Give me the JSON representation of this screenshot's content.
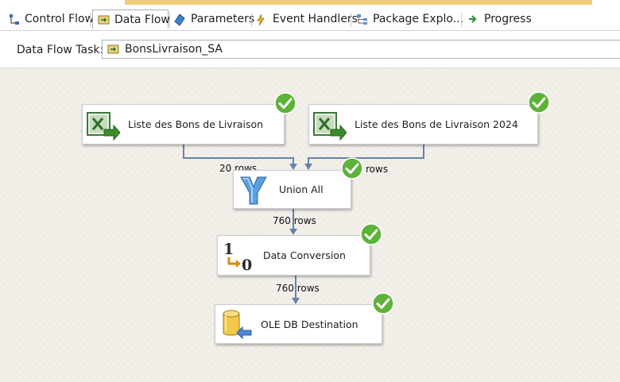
{
  "tabs": [
    {
      "label": "Control Flow",
      "icon": "control-flow-icon"
    },
    {
      "label": "Data Flow",
      "icon": "data-flow-icon",
      "active": true
    },
    {
      "label": "Parameters",
      "icon": "parameters-icon"
    },
    {
      "label": "Event Handlers",
      "icon": "event-handlers-icon"
    },
    {
      "label": "Package Explo...",
      "icon": "package-explorer-icon"
    },
    {
      "label": "Progress",
      "icon": "progress-icon"
    }
  ],
  "task": {
    "label": "Data Flow Task:",
    "value": "BonsLivraison_SA"
  },
  "components": [
    {
      "label": "Liste des Bons de Livraison",
      "icon": "excel-source-icon",
      "status": "success"
    },
    {
      "label": "Liste des Bons de Livraison 2024",
      "icon": "excel-source-icon",
      "status": "success"
    },
    {
      "label": "Union All",
      "icon": "union-all-icon",
      "status": "success"
    },
    {
      "label": "Data Conversion",
      "icon": "data-conversion-icon",
      "status": "success"
    },
    {
      "label": "OLE DB Destination",
      "icon": "ole-db-destination-icon",
      "status": "success"
    }
  ],
  "paths": [
    {
      "label": "20 rows"
    },
    {
      "label": "rows"
    },
    {
      "label": "760 rows"
    },
    {
      "label": "760 rows"
    }
  ],
  "colors": {
    "accent": "#ecce7c",
    "success": "#5cb338",
    "path": "#6582ad",
    "canvas": "#f3f0ea"
  }
}
